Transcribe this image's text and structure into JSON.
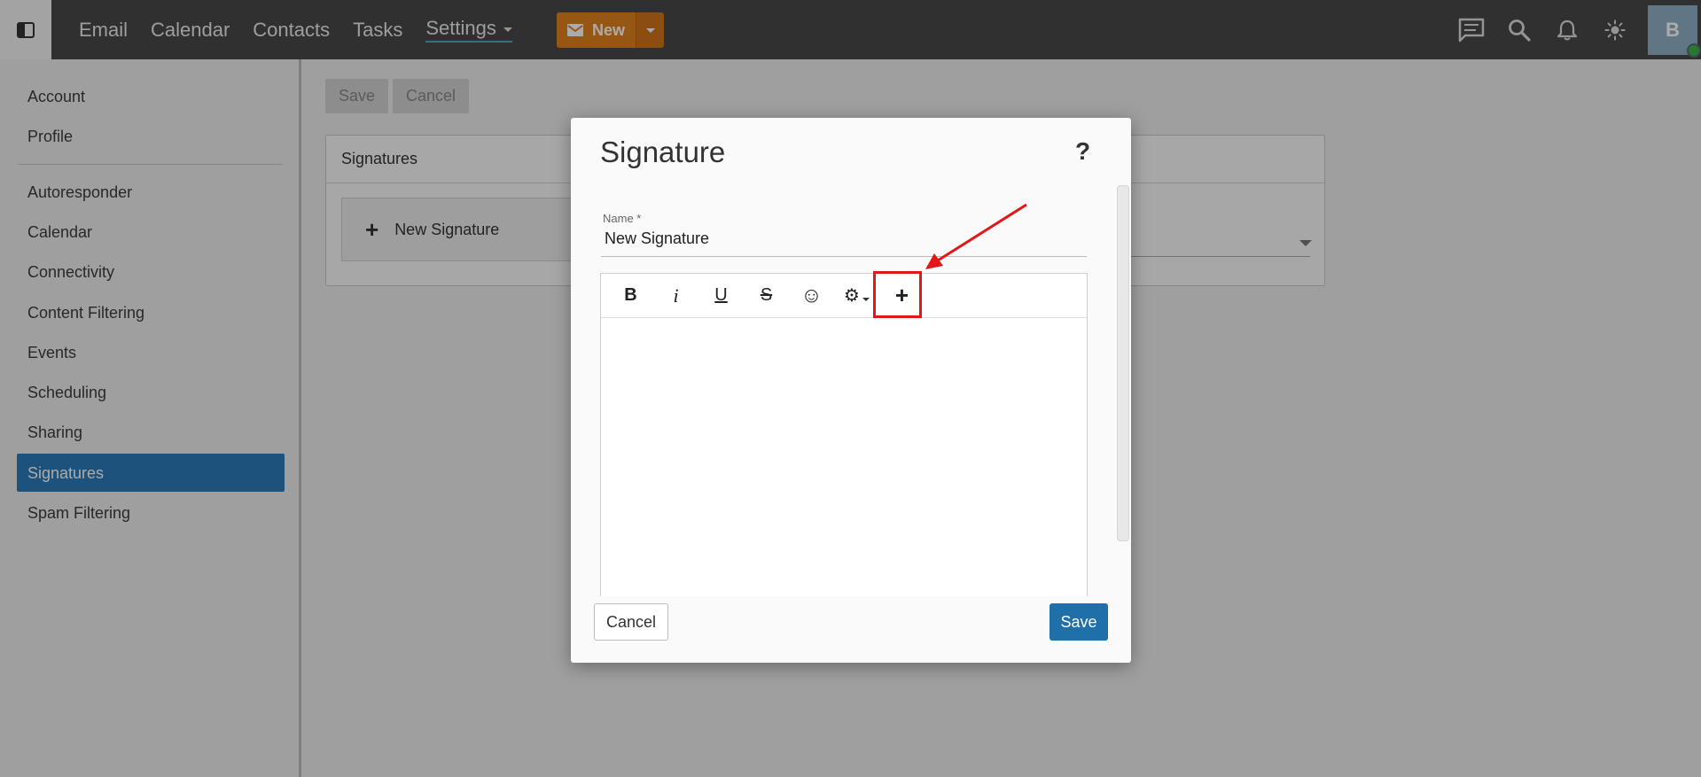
{
  "topbar": {
    "nav": [
      "Email",
      "Calendar",
      "Contacts",
      "Tasks"
    ],
    "settings_label": "Settings",
    "new_label": "New",
    "avatar_initial": "B"
  },
  "sidebar": {
    "items_top": [
      "Account",
      "Profile"
    ],
    "items": [
      "Autoresponder",
      "Calendar",
      "Connectivity",
      "Content Filtering",
      "Events",
      "Scheduling",
      "Sharing",
      "Signatures",
      "Spam Filtering"
    ]
  },
  "main": {
    "save_label": "Save",
    "cancel_label": "Cancel",
    "panel_title": "Signatures",
    "new_signature_label": "New Signature"
  },
  "modal": {
    "title": "Signature",
    "help": "?",
    "name_label": "Name *",
    "name_value": "New Signature",
    "toolbar": {
      "bold": "B",
      "italic": "i",
      "underline": "U",
      "strike": "S",
      "emoji": "☺",
      "settings": "⚙",
      "insert": "+"
    },
    "cancel_label": "Cancel",
    "save_label": "Save"
  },
  "colors": {
    "accent": "#e1821f",
    "selection": "#2b7bb9",
    "primary_button": "#1f6fa8",
    "highlight": "#e01818"
  }
}
